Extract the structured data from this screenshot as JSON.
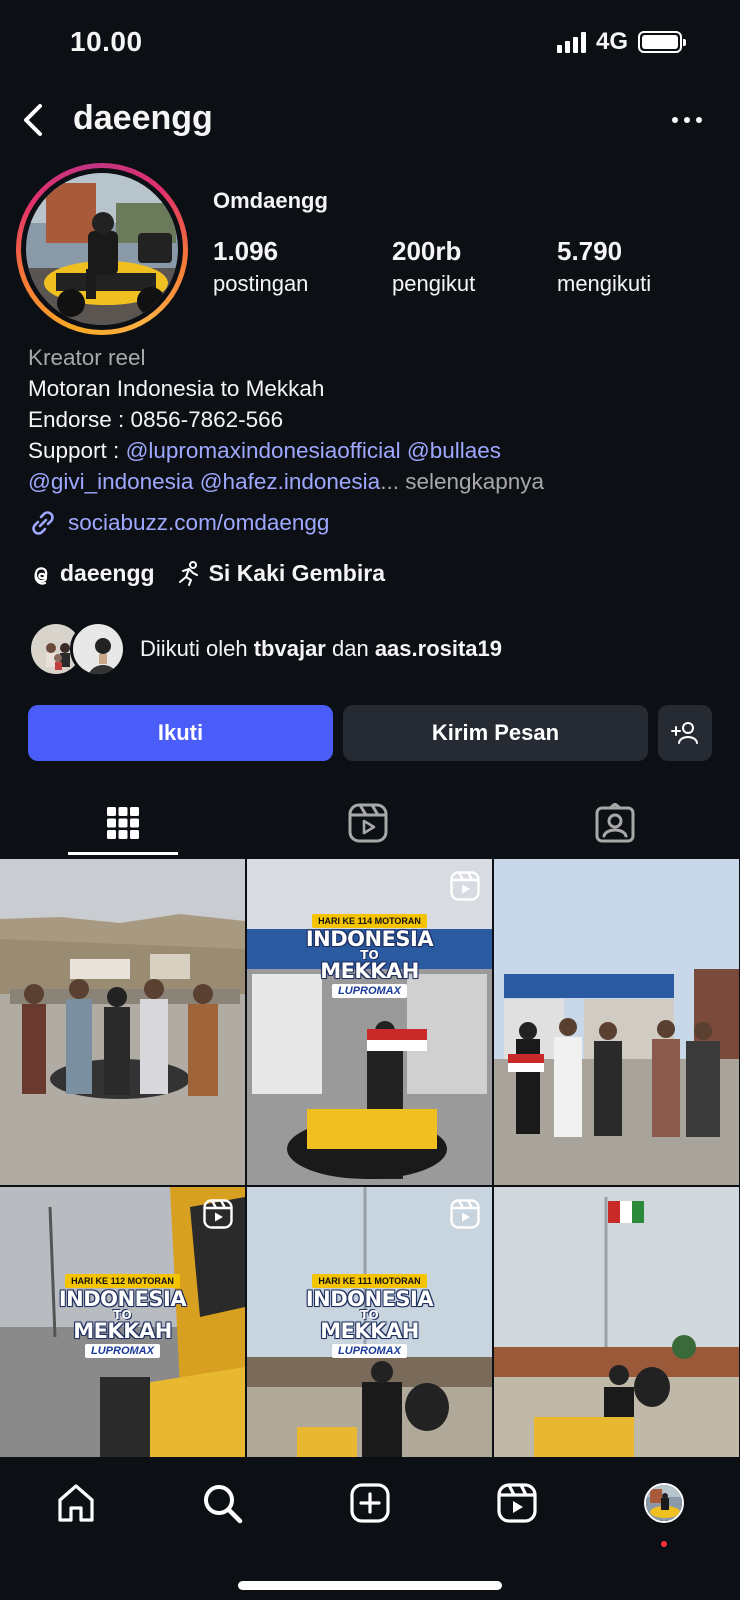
{
  "status_bar": {
    "time": "10.00",
    "network": "4G"
  },
  "header": {
    "username": "daeengg"
  },
  "profile": {
    "display_name": "Omdaengg",
    "stats": [
      {
        "value": "1.096",
        "label": "postingan"
      },
      {
        "value": "200rb",
        "label": "pengikut"
      },
      {
        "value": "5.790",
        "label": "mengikuti"
      }
    ],
    "category": "Kreator reel",
    "bio_line1": "Motoran Indonesia to Mekkah",
    "bio_line2": "Endorse : 0856-7862-566",
    "support_prefix": "Support : ",
    "mentions": [
      "@lupromaxindonesiaofficial",
      "@bullaes",
      "@givi_indonesia",
      "@hafez.indonesia"
    ],
    "ellipsis": "...",
    "more_label": " selengkapnya",
    "link": "sociabuzz.com/omdaengg",
    "threads_handle": "daeengg",
    "community": "Si Kaki Gembira",
    "followed_by": {
      "prefix": "Diikuti oleh ",
      "user1": "tbvajar",
      "conj": " dan ",
      "user2": "aas.rosita19"
    }
  },
  "actions": {
    "follow": "Ikuti",
    "message": "Kirim Pesan"
  },
  "tabs": [
    "posts-grid",
    "reels",
    "tagged"
  ],
  "posts": [
    {
      "type": "photo"
    },
    {
      "type": "reel",
      "day": "HARI KE 114 MOTORAN",
      "line1": "INDONESIA",
      "line2": "TO",
      "line3": "MEKKAH",
      "brand": "LUPROMAX"
    },
    {
      "type": "photo"
    },
    {
      "type": "reel",
      "day": "HARI KE 112 MOTORAN",
      "line1": "INDONESIA",
      "line2": "TO",
      "line3": "MEKKAH",
      "brand": "LUPROMAX"
    },
    {
      "type": "reel",
      "day": "HARI KE 111 MOTORAN",
      "line1": "INDONESIA",
      "line2": "TO",
      "line3": "MEKKAH",
      "brand": "LUPROMAX"
    },
    {
      "type": "photo"
    }
  ],
  "colors": {
    "accent": "#4a5df9",
    "mention": "#9fa8ff",
    "background": "#0c0f14",
    "secondary_button": "#262a32"
  }
}
